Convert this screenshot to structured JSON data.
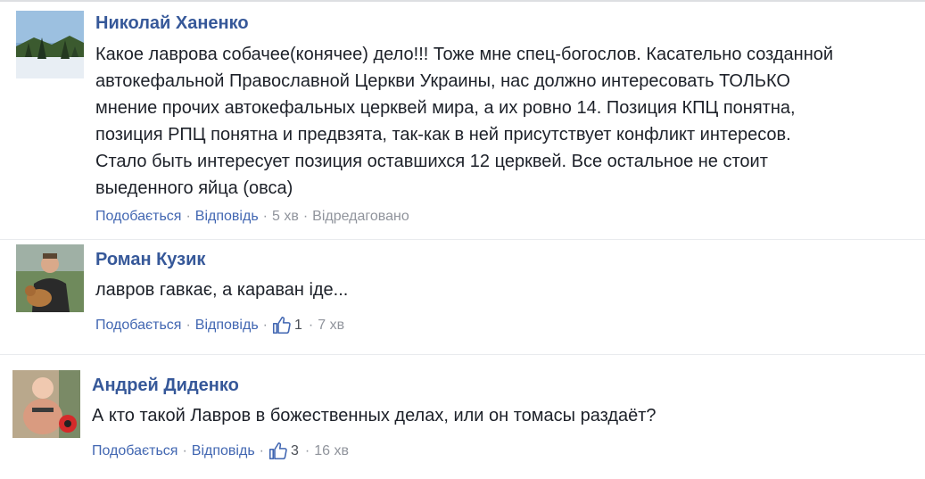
{
  "colors": {
    "link": "#365899",
    "action_link": "#4267b2",
    "meta": "#90949c",
    "text": "#1d2129",
    "like_icon": "#4267b2"
  },
  "comments": [
    {
      "author": "Николай Ханенко",
      "avatar_icon": "winter-landscape-avatar",
      "lines": [
        "Какое лаврова собачее(конячее) дело!!! Тоже мне спец-богослов. Касательно созданной",
        "автокефальной Православной Церкви Украины, нас должно интересовать ТОЛЬКО",
        "мнение прочих автокефальных церквей мира, а их ровно 14. Позиция КПЦ понятна,",
        "позиция РПЦ понятна и предвзята, так-как в ней присутствует конфликт интересов.",
        "Стало быть интересует позиция оставшихся 12 церквей. Все остальное не стоит",
        "выеденного яйца (овса)"
      ],
      "like_label": "Подобається",
      "reply_label": "Відповідь",
      "time": "5 хв",
      "edited": "Відредаговано"
    },
    {
      "author": "Роман Кузик",
      "avatar_icon": "man-with-dog-avatar",
      "lines": [
        "лавров гавкає, а караван іде..."
      ],
      "like_label": "Подобається",
      "reply_label": "Відповідь",
      "likes": "1",
      "time": "7 хв"
    },
    {
      "author": "Андрей Диденко",
      "avatar_icon": "man-with-child-avatar",
      "lines": [
        "А кто такой Лавров в божественных делах, или он томасы раздаёт?"
      ],
      "like_label": "Подобається",
      "reply_label": "Відповідь",
      "likes": "3",
      "time": "16 хв"
    }
  ]
}
